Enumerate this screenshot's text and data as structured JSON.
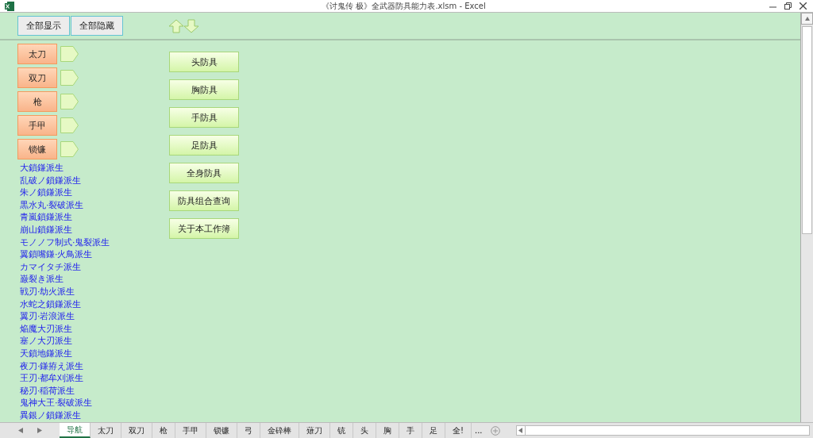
{
  "window": {
    "title": "《讨鬼传 极》全武器防具能力表.xlsm - Excel"
  },
  "toolbar": {
    "buttons": [
      "全部显示",
      "全部隐藏"
    ]
  },
  "weapons": [
    {
      "label": "太刀"
    },
    {
      "label": "双刀"
    },
    {
      "label": "枪"
    },
    {
      "label": "手甲"
    },
    {
      "label": "锁镰"
    }
  ],
  "links": [
    "大鎖鎌派生",
    "乱破ノ鎖鎌派生",
    "朱ノ鎖鎌派生",
    "黒水丸·裂破派生",
    "青嵐鎖鎌派生",
    "崩山鎖鎌派生",
    "モノノフ制式·鬼裂派生",
    "翼鎖嘴鎌·火鳥派生",
    "カマイタチ派生",
    "巌裂き派生",
    "戦刃·劫火派生",
    "水蛇之鎖鎌派生",
    "翼刃·岩浪派生",
    "焔魔大刃派生",
    "塞ノ大刃派生",
    "天鎖地鎌派生",
    "夜刀·鎌拵え派生",
    "王刃·都牟刈派生",
    "秘刃·稲荷派生",
    "鬼神大王·裂破派生",
    "異銀ノ鎖鎌派生"
  ],
  "armor_buttons": [
    "头防具",
    "胸防具",
    "手防具",
    "足防具",
    "全身防具",
    "防具组合查询",
    "关于本工作簿"
  ],
  "sheet_tabs": [
    {
      "label": "导航",
      "selected": true
    },
    {
      "label": "太刀",
      "selected": false
    },
    {
      "label": "双刀",
      "selected": false
    },
    {
      "label": "枪",
      "selected": false
    },
    {
      "label": "手甲",
      "selected": false
    },
    {
      "label": "锁镰",
      "selected": false
    },
    {
      "label": "弓",
      "selected": false
    },
    {
      "label": "金砕棒",
      "selected": false
    },
    {
      "label": "薙刀",
      "selected": false
    },
    {
      "label": "铳",
      "selected": false
    },
    {
      "label": "头",
      "selected": false
    },
    {
      "label": "胸",
      "selected": false
    },
    {
      "label": "手",
      "selected": false
    },
    {
      "label": "足",
      "selected": false
    },
    {
      "label": "全!",
      "selected": false
    }
  ],
  "tab_overflow": "..."
}
